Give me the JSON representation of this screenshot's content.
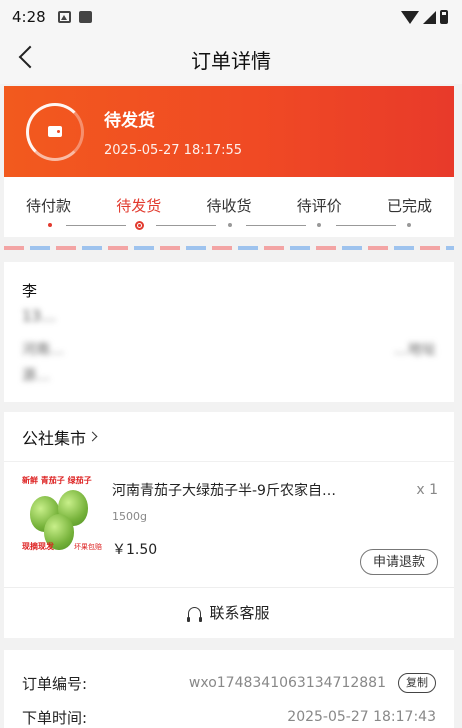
{
  "statusbar": {
    "time": "4:28"
  },
  "nav": {
    "title": "订单详情"
  },
  "banner": {
    "status": "待发货",
    "time": "2025-05-27 18:17:55"
  },
  "steps": [
    "待付款",
    "待发货",
    "待收货",
    "待评价",
    "已完成"
  ],
  "address": {
    "name": "李",
    "phone": "13…",
    "line1_left": "河南…",
    "line1_right": "…地址",
    "line2": "源…"
  },
  "shop": {
    "name": "公社集市"
  },
  "item": {
    "name": "河南青茄子大绿茄子半-9斤农家自…",
    "spec": "1500g",
    "price": "￥1.50",
    "qty": "x 1",
    "refund_label": "申请退款",
    "thumb_tag1": "新鲜 青茄子 绿茄子",
    "thumb_tag2": "现摘现发",
    "thumb_tag3": "坏果包赔"
  },
  "contact_label": "联系客服",
  "meta": {
    "order_no_label": "订单编号:",
    "order_no": "wxo1748341063134712881",
    "copy_label": "复制",
    "order_time_label": "下单时间:",
    "order_time": "2025-05-27 18:17:43"
  },
  "colors": {
    "accent": "#e23b2f",
    "banner_start": "#f25a1e",
    "banner_end": "#e83a2a"
  }
}
